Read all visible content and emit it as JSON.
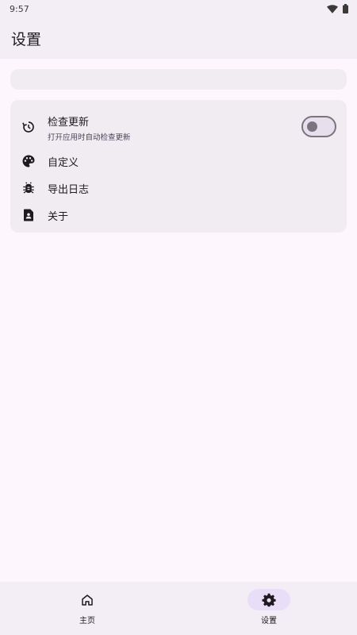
{
  "status_bar": {
    "time": "9:57",
    "wifi_icon": "wifi-icon",
    "battery_icon": "battery-icon"
  },
  "app_bar": {
    "title": "设置"
  },
  "settings": {
    "check_update": {
      "label": "检查更新",
      "subtitle": "打开应用时自动检查更新",
      "icon": "history-icon",
      "enabled": false
    },
    "customize": {
      "label": "自定义",
      "icon": "palette-icon"
    },
    "export_logs": {
      "label": "导出日志",
      "icon": "bug-icon"
    },
    "about": {
      "label": "关于",
      "icon": "contact-page-icon"
    }
  },
  "bottom_nav": {
    "items": [
      {
        "label": "主页",
        "icon": "home-icon",
        "active": false
      },
      {
        "label": "设置",
        "icon": "gear-icon",
        "active": true
      }
    ]
  },
  "colors": {
    "background": "#fdf7fd",
    "surface": "#f3eef5",
    "active_indicator": "#e8def8",
    "on_surface": "#1d1b20"
  }
}
